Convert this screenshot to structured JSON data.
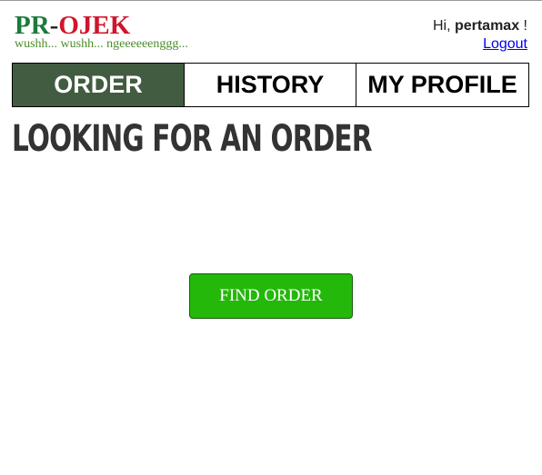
{
  "header": {
    "logo": {
      "part1": "PR",
      "separator": "-",
      "part2": "OJEK"
    },
    "tagline": "wushh... wushh... ngeeeeeenggg...",
    "greeting_prefix": "Hi, ",
    "username": "pertamax",
    "greeting_suffix": " !",
    "logout_label": "Logout"
  },
  "tabs": [
    {
      "label": "ORDER",
      "active": true
    },
    {
      "label": "HISTORY",
      "active": false
    },
    {
      "label": "MY PROFILE",
      "active": false
    }
  ],
  "main": {
    "title": "LOOKING FOR AN ORDER",
    "find_button_label": "FIND ORDER"
  },
  "colors": {
    "logo_green": "#1a7a3c",
    "logo_red": "#d0142c",
    "tagline_green": "#4c8b2b",
    "active_tab_bg": "#425c42",
    "button_green": "#24b80a"
  }
}
